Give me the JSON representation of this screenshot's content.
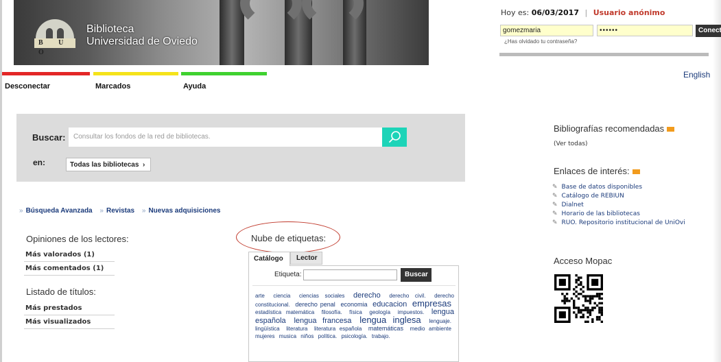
{
  "header": {
    "logo_letters": "B U O",
    "library_line1": "Biblioteca",
    "library_line2": "Universidad de Oviedo"
  },
  "nav": {
    "items": [
      "Desconectar",
      "Marcados",
      "Ayuda"
    ],
    "bar_colors": [
      "#e32626",
      "#f5e31a",
      "#3fd12f"
    ]
  },
  "session": {
    "date_prefix": "Hoy es:",
    "date": "06/03/2017",
    "user": "Usuario anónimo",
    "username_value": "gomezmaria",
    "password_value": "••••••",
    "connect_label": "Conectar",
    "forgot_label": "¿Has olvidado tu contraseña?",
    "language_link": "English"
  },
  "search": {
    "label": "Buscar:",
    "placeholder": "Consultar los fondos de la red de bibliotecas.",
    "in_label": "en:",
    "library_select": "Todas las bibliotecas",
    "accent_color": "#1dd4b8"
  },
  "quick_links": [
    "Búsqueda Avanzada",
    "Revistas",
    "Nuevas adquisiciones"
  ],
  "opinions": {
    "title": "Opiniones de los lectores:",
    "items": [
      "Más valorados (1)",
      "Más comentados (1)"
    ]
  },
  "titles_list": {
    "title": "Listado de títulos:",
    "items": [
      "Más prestados",
      "Más visualizados"
    ]
  },
  "tag_cloud": {
    "title": "Nube de etiquetas:",
    "tabs": [
      "Catálogo",
      "Lector"
    ],
    "tag_label": "Etiqueta:",
    "search_button": "Buscar",
    "tags": [
      {
        "text": "arte",
        "size": 1
      },
      {
        "text": "ciencia",
        "size": 1
      },
      {
        "text": "ciencias sociales",
        "size": 1
      },
      {
        "text": "derecho",
        "size": 3
      },
      {
        "text": "derecho civil.",
        "size": 1
      },
      {
        "text": "derecho constitucional.",
        "size": 1
      },
      {
        "text": "derecho penal",
        "size": 2
      },
      {
        "text": "economia",
        "size": 2
      },
      {
        "text": "educacion",
        "size": 3
      },
      {
        "text": "empresas",
        "size": 4
      },
      {
        "text": "estadística matemática",
        "size": 1
      },
      {
        "text": "filosofía.",
        "size": 1
      },
      {
        "text": "física",
        "size": 1
      },
      {
        "text": "geología",
        "size": 1
      },
      {
        "text": "impuestos.",
        "size": 1
      },
      {
        "text": "lengua española",
        "size": 3
      },
      {
        "text": "lengua francesa",
        "size": 3
      },
      {
        "text": "lengua inglesa",
        "size": 4
      },
      {
        "text": "lenguaje.",
        "size": 1
      },
      {
        "text": "lingüística",
        "size": 1
      },
      {
        "text": "literatura",
        "size": 1
      },
      {
        "text": "literatura española",
        "size": 1
      },
      {
        "text": "matemáticas",
        "size": 2
      },
      {
        "text": "medio ambiente",
        "size": 1
      },
      {
        "text": "mujeres",
        "size": 1
      },
      {
        "text": "musica",
        "size": 1
      },
      {
        "text": "niños",
        "size": 1
      },
      {
        "text": "política.",
        "size": 1
      },
      {
        "text": "psicología.",
        "size": 1
      },
      {
        "text": "trabajo.",
        "size": 1
      }
    ]
  },
  "right": {
    "bibliographies_title": "Bibliografías recomendadas",
    "see_all": "(Ver todas)",
    "links_title": "Enlaces de interés:",
    "links": [
      "Base de datos disponibles",
      "Catálogo de REBIUN",
      "Dialnet",
      "Horario de las bibliotecas",
      "RUO. Repositorio institucional de UniOvi"
    ],
    "mopac_title": "Acceso Mopac",
    "rss_color": "#f29b1d"
  }
}
